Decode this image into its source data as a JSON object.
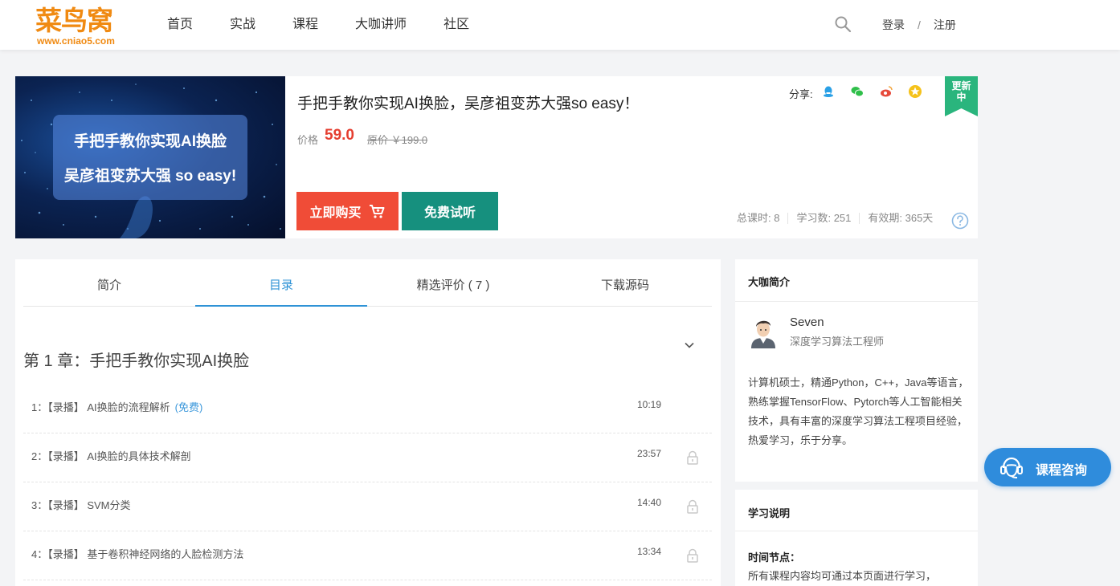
{
  "header": {
    "logo_main": "菜鸟窝",
    "logo_sub": "www.cniao5.com",
    "nav": [
      "首页",
      "实战",
      "课程",
      "大咖讲师",
      "社区"
    ],
    "login": "登录",
    "separator": "/",
    "register": "注册"
  },
  "course": {
    "banner_line1": "手把手教你实现AI换脸",
    "banner_line2": "吴彦祖变苏大强 so easy!",
    "title": "手把手教你实现AI换脸，吴彦祖变苏大强so easy！",
    "price_label": "价格",
    "price": "59.0",
    "original_price": "原价 ￥199.0",
    "share_label": "分享:",
    "badge_line1": "更新",
    "badge_line2": "中",
    "buy_label": "立即购买",
    "trial_label": "免费试听",
    "stats": {
      "lessons": "总课时: 8",
      "learners": "学习数: 251",
      "validity": "有效期: 365天"
    }
  },
  "tabs": [
    {
      "label": "简介"
    },
    {
      "label": "目录"
    },
    {
      "label": "精选评价 ( 7 )"
    },
    {
      "label": "下载源码"
    }
  ],
  "chapter": {
    "title": "第 1 章：手把手教你实现AI换脸",
    "lessons": [
      {
        "text": "1：【录播】 AI换脸的流程解析",
        "free": "(免费)",
        "time": "10:19"
      },
      {
        "text": "2：【录播】 AI换脸的具体技术解剖",
        "free": "",
        "time": "23:57"
      },
      {
        "text": "3：【录播】 SVM分类",
        "free": "",
        "time": "14:40"
      },
      {
        "text": "4：【录播】 基于卷积神经网络的人脸检测方法",
        "free": "",
        "time": "13:34"
      }
    ]
  },
  "sidebar": {
    "teacher_title": "大咖简介",
    "teacher_name": "Seven",
    "teacher_role": "深度学习算法工程师",
    "teacher_bio": "计算机硕士，精通Python，C++，Java等语言，熟练掌握TensorFlow、Pytorch等人工智能相关技术，具有丰富的深度学习算法工程项目经验，热爱学习，乐于分享。",
    "study_title": "学习说明",
    "time_label": "时间节点：",
    "time_desc": "所有课程内容均可通过本页面进行学习，"
  },
  "consult_label": "课程咨询",
  "colors": {
    "accent_blue": "#2f93d6",
    "buy_red": "#f04c37",
    "trial_green": "#16907e",
    "price_red": "#e53e30",
    "logo_orange": "#f08a12"
  }
}
